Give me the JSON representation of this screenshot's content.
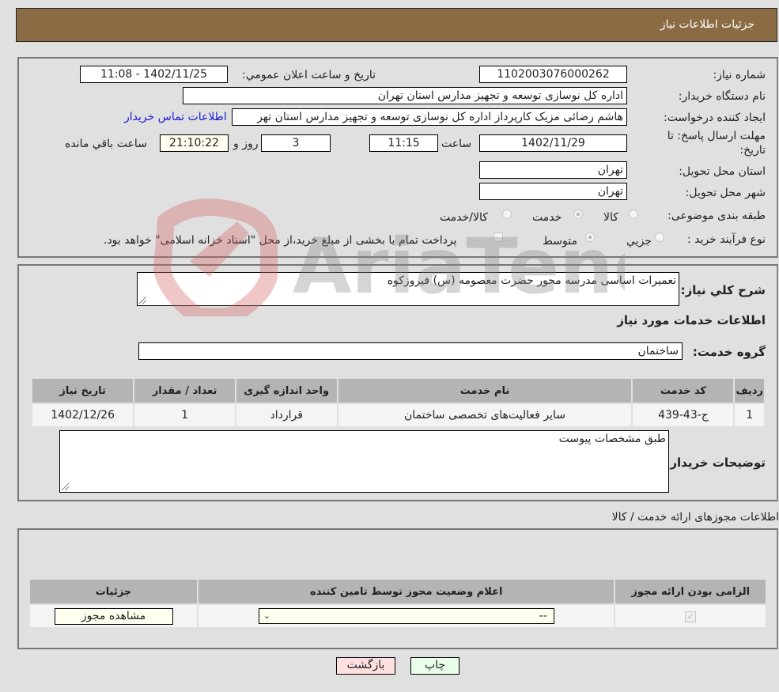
{
  "header": {
    "title": "جزئیات اطلاعات نیاز"
  },
  "need_info": {
    "need_number_label": "شماره نیاز:",
    "need_number": "1102003076000262",
    "announce_label": "تاریخ و ساعت اعلان عمومي:",
    "announce_value": "1402/11/25 - 11:08",
    "buyer_org_label": "نام دستگاه خریدار:",
    "buyer_org": "اداره کل نوسازی  توسعه و تجهیز مدارس استان تهران",
    "creator_label": "ایجاد کننده درخواست:",
    "creator": "هاشم رضائی مزیک کارپرداز اداره کل نوسازی  توسعه و تجهیز مدارس استان تهر",
    "contact_link": "اطلاعات تماس خریدار",
    "deadline_label_1": "مهلت ارسال پاسخ: تا",
    "deadline_label_2": "تاریخ:",
    "deadline_date": "1402/11/29",
    "time_label": "ساعت",
    "deadline_time": "11:15",
    "days_value": "3",
    "days_label": "روز و",
    "remaining_time": "21:10:22",
    "remaining_label": "ساعت باقي مانده",
    "province_label": "استان محل تحویل:",
    "province": "تهران",
    "city_label": "شهر محل تحویل:",
    "city": "تهران",
    "category_label": "طبقه بندی موضوعی:",
    "category_options": [
      {
        "label": "کالا",
        "checked": false
      },
      {
        "label": "خدمت",
        "checked": true
      },
      {
        "label": "کالا/خدمت",
        "checked": false
      }
    ],
    "process_label": "نوع فرآیند خرید :",
    "process_options": [
      {
        "label": "جزيي",
        "checked": false
      },
      {
        "label": "متوسط",
        "checked": true
      }
    ],
    "treasury_note": "پرداخت تمام یا بخشی از مبلغ خرید،از محل \"اسناد خزانه اسلامی\" خواهد بود.",
    "treasury_checked": false
  },
  "description": {
    "label": "شرح کلي نیاز:",
    "value": "تعمیرات اساسی مدرسه محور حضرت معصومه (س) فیروزکوه",
    "services_title": "اطلاعات خدمات مورد نیاز",
    "service_group_label": "گروه خدمت:",
    "service_group": "ساختمان"
  },
  "services_table": {
    "columns": [
      "ردیف",
      "کد خدمت",
      "نام خدمت",
      "واحد اندازه گیری",
      "تعداد / مقدار",
      "تاریخ نیاز"
    ],
    "rows": [
      [
        "1",
        "ج-43-439",
        "سایر فعالیت‌های تخصصی ساختمان",
        "قرارداد",
        "1",
        "1402/12/26"
      ]
    ]
  },
  "buyer_notes": {
    "label": "توضیحات خریدار:",
    "value": "طبق مشخصات پیوست"
  },
  "permits": {
    "section_title": "اطلاعات مجوزهای ارائه خدمت / کالا",
    "columns": [
      "الزامی بودن ارائه مجوز",
      "اعلام وضعیت مجوز توسط تامین کننده",
      "جزئیات"
    ],
    "row": {
      "required_checked": true,
      "status_select": "--",
      "view_button": "مشاهده مجوز"
    }
  },
  "footer": {
    "print_button": "چاپ",
    "back_button": "بازگشت"
  },
  "watermark": {
    "text": "AriaTender.neT"
  }
}
